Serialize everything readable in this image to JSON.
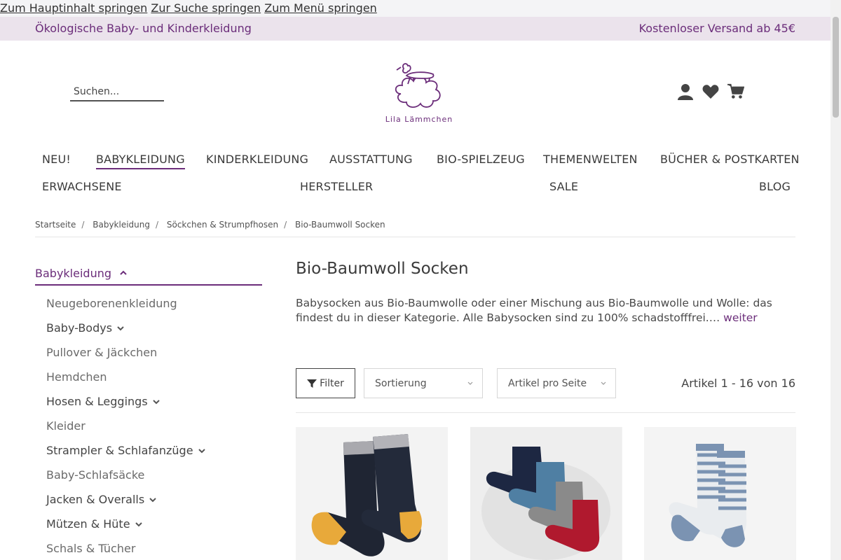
{
  "skiplinks": [
    "Zum Hauptinhalt springen",
    "Zur Suche springen",
    "Zum Menü springen"
  ],
  "topbar": {
    "left": "Ökologische Baby- und Kinderkleidung",
    "right": "Kostenloser Versand ab 45€"
  },
  "search": {
    "placeholder": "Suchen..."
  },
  "logo": {
    "text": "Lila Lämmchen"
  },
  "header_icons": [
    "user-icon",
    "heart-icon",
    "cart-icon"
  ],
  "nav": {
    "row1": [
      "NEU!",
      "BABYKLEIDUNG",
      "KINDERKLEIDUNG",
      "AUSSTATTUNG",
      "BIO-SPIELZEUG",
      "THEMENWELTEN",
      "BÜCHER & POSTKARTEN"
    ],
    "row2": [
      "ERWACHSENE",
      "HERSTELLER",
      "SALE",
      "BLOG"
    ],
    "active": "BABYKLEIDUNG"
  },
  "breadcrumb": [
    "Startseite",
    "Babykleidung",
    "Söckchen & Strumpfhosen",
    "Bio-Baumwoll Socken"
  ],
  "sidebar": {
    "heading": "Babykleidung",
    "items": [
      {
        "label": "Neugeborenenkleidung",
        "has_children": false
      },
      {
        "label": "Baby-Bodys",
        "has_children": true
      },
      {
        "label": "Pullover & Jäckchen",
        "has_children": false
      },
      {
        "label": "Hemdchen",
        "has_children": false
      },
      {
        "label": "Hosen & Leggings",
        "has_children": true
      },
      {
        "label": "Kleider",
        "has_children": false
      },
      {
        "label": "Strampler & Schlafanzüge",
        "has_children": true
      },
      {
        "label": "Baby-Schlafsäcke",
        "has_children": false
      },
      {
        "label": "Jacken & Overalls",
        "has_children": true
      },
      {
        "label": "Mützen & Hüte",
        "has_children": true
      },
      {
        "label": "Schals & Tücher",
        "has_children": false
      }
    ]
  },
  "category": {
    "title": "Bio-Baumwoll Socken",
    "description": "Babysocken aus Bio-Baumwolle oder einer Mischung aus Bio-Baumwolle und Wolle: das findest du in dieser Kategorie. Alle Babysocken sind zu 100% schadstofffrei.…",
    "more": "weiter"
  },
  "toolbar": {
    "filter_label": "Filter",
    "sort_label": "Sortierung",
    "per_page_label": "Artikel pro Seite",
    "count": "Artikel 1 - 16 von 16"
  },
  "colors": {
    "brand": "#6b2d7a",
    "topbar_bg": "#ebe3ec"
  }
}
